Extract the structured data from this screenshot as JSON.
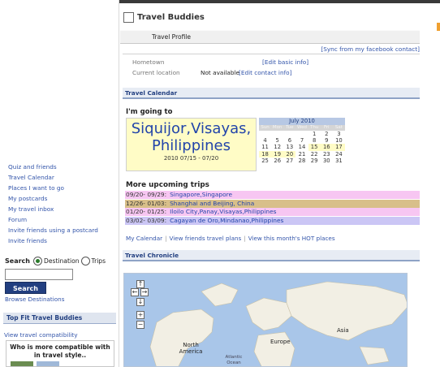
{
  "app": {
    "title": "Travel Buddies",
    "subtab": "Travel Profile"
  },
  "profile": {
    "sync_link": "[Sync from my facebook contact]",
    "hometown_label": "Hometown",
    "hometown_edit": "[Edit basic info]",
    "location_label": "Current location",
    "location_value": "Not available",
    "location_edit": "[Edit contact info]"
  },
  "calendar_section": {
    "header": "Travel Calendar",
    "going_to": "I'm going to",
    "destination": "Siquijor,Visayas, Philippines",
    "dates": "2010 07/15 - 07/20"
  },
  "mini_calendar": {
    "month": "July 2010",
    "weekdays": [
      "Sun",
      "Mon",
      "Tue",
      "Wed",
      "Thu",
      "Fri",
      "Sat"
    ],
    "weeks": [
      [
        "",
        "",
        "",
        "",
        "1",
        "2",
        "3"
      ],
      [
        "4",
        "5",
        "6",
        "7",
        "8",
        "9",
        "10"
      ],
      [
        "11",
        "12",
        "13",
        "14",
        "15",
        "16",
        "17"
      ],
      [
        "18",
        "19",
        "20",
        "21",
        "22",
        "23",
        "24"
      ],
      [
        "25",
        "26",
        "27",
        "28",
        "29",
        "30",
        "31"
      ]
    ],
    "highlighted_days": [
      "15",
      "16",
      "17",
      "18",
      "19",
      "20"
    ]
  },
  "upcoming": {
    "header": "More upcoming trips",
    "trips": [
      {
        "dates": "09/20- 09/29:",
        "name": "Singapore,Singapore",
        "color": "#f7c6f2"
      },
      {
        "dates": "12/26- 01/03:",
        "name": "Shanghai and Beijing, China",
        "color": "#d8bf8a"
      },
      {
        "dates": "01/20- 01/25:",
        "name": "Iloilo City,Panay,Visayas,Philippines",
        "color": "#f7c6f2"
      },
      {
        "dates": "03/02- 03/09:",
        "name": "Cagayan de Oro,Mindanao,Philippines",
        "color": "#cbc6f5"
      }
    ]
  },
  "calendar_links": {
    "my_calendar": "My Calendar",
    "friends_plans": "View friends travel plans",
    "hot_places": "View this month's HOT places"
  },
  "chronicle": {
    "header": "Travel Chronicle",
    "labels": {
      "asia": "Asia",
      "europe": "Europe",
      "north_america": "North America",
      "atlantic": "Atlantic Ocean"
    }
  },
  "left_menu": {
    "items": [
      "Quiz and friends",
      "Travel Calendar",
      "Places I want to go",
      "My postcards",
      "My travel inbox",
      "Forum",
      "Invite friends using a postcard",
      "Invite friends"
    ]
  },
  "search": {
    "label": "Search",
    "option_destination": "Destination",
    "option_trips": "Trips",
    "button": "Search",
    "browse": "Browse Destinations"
  },
  "top_fit": {
    "header": "Top Fit Travel Buddies",
    "view_link": "View travel compatibility",
    "box_text": "Who is more compatible with in travel style.."
  },
  "colors": {
    "accent": "#223f80",
    "link": "#3355aa",
    "destination_bg": "#fffcc6"
  }
}
